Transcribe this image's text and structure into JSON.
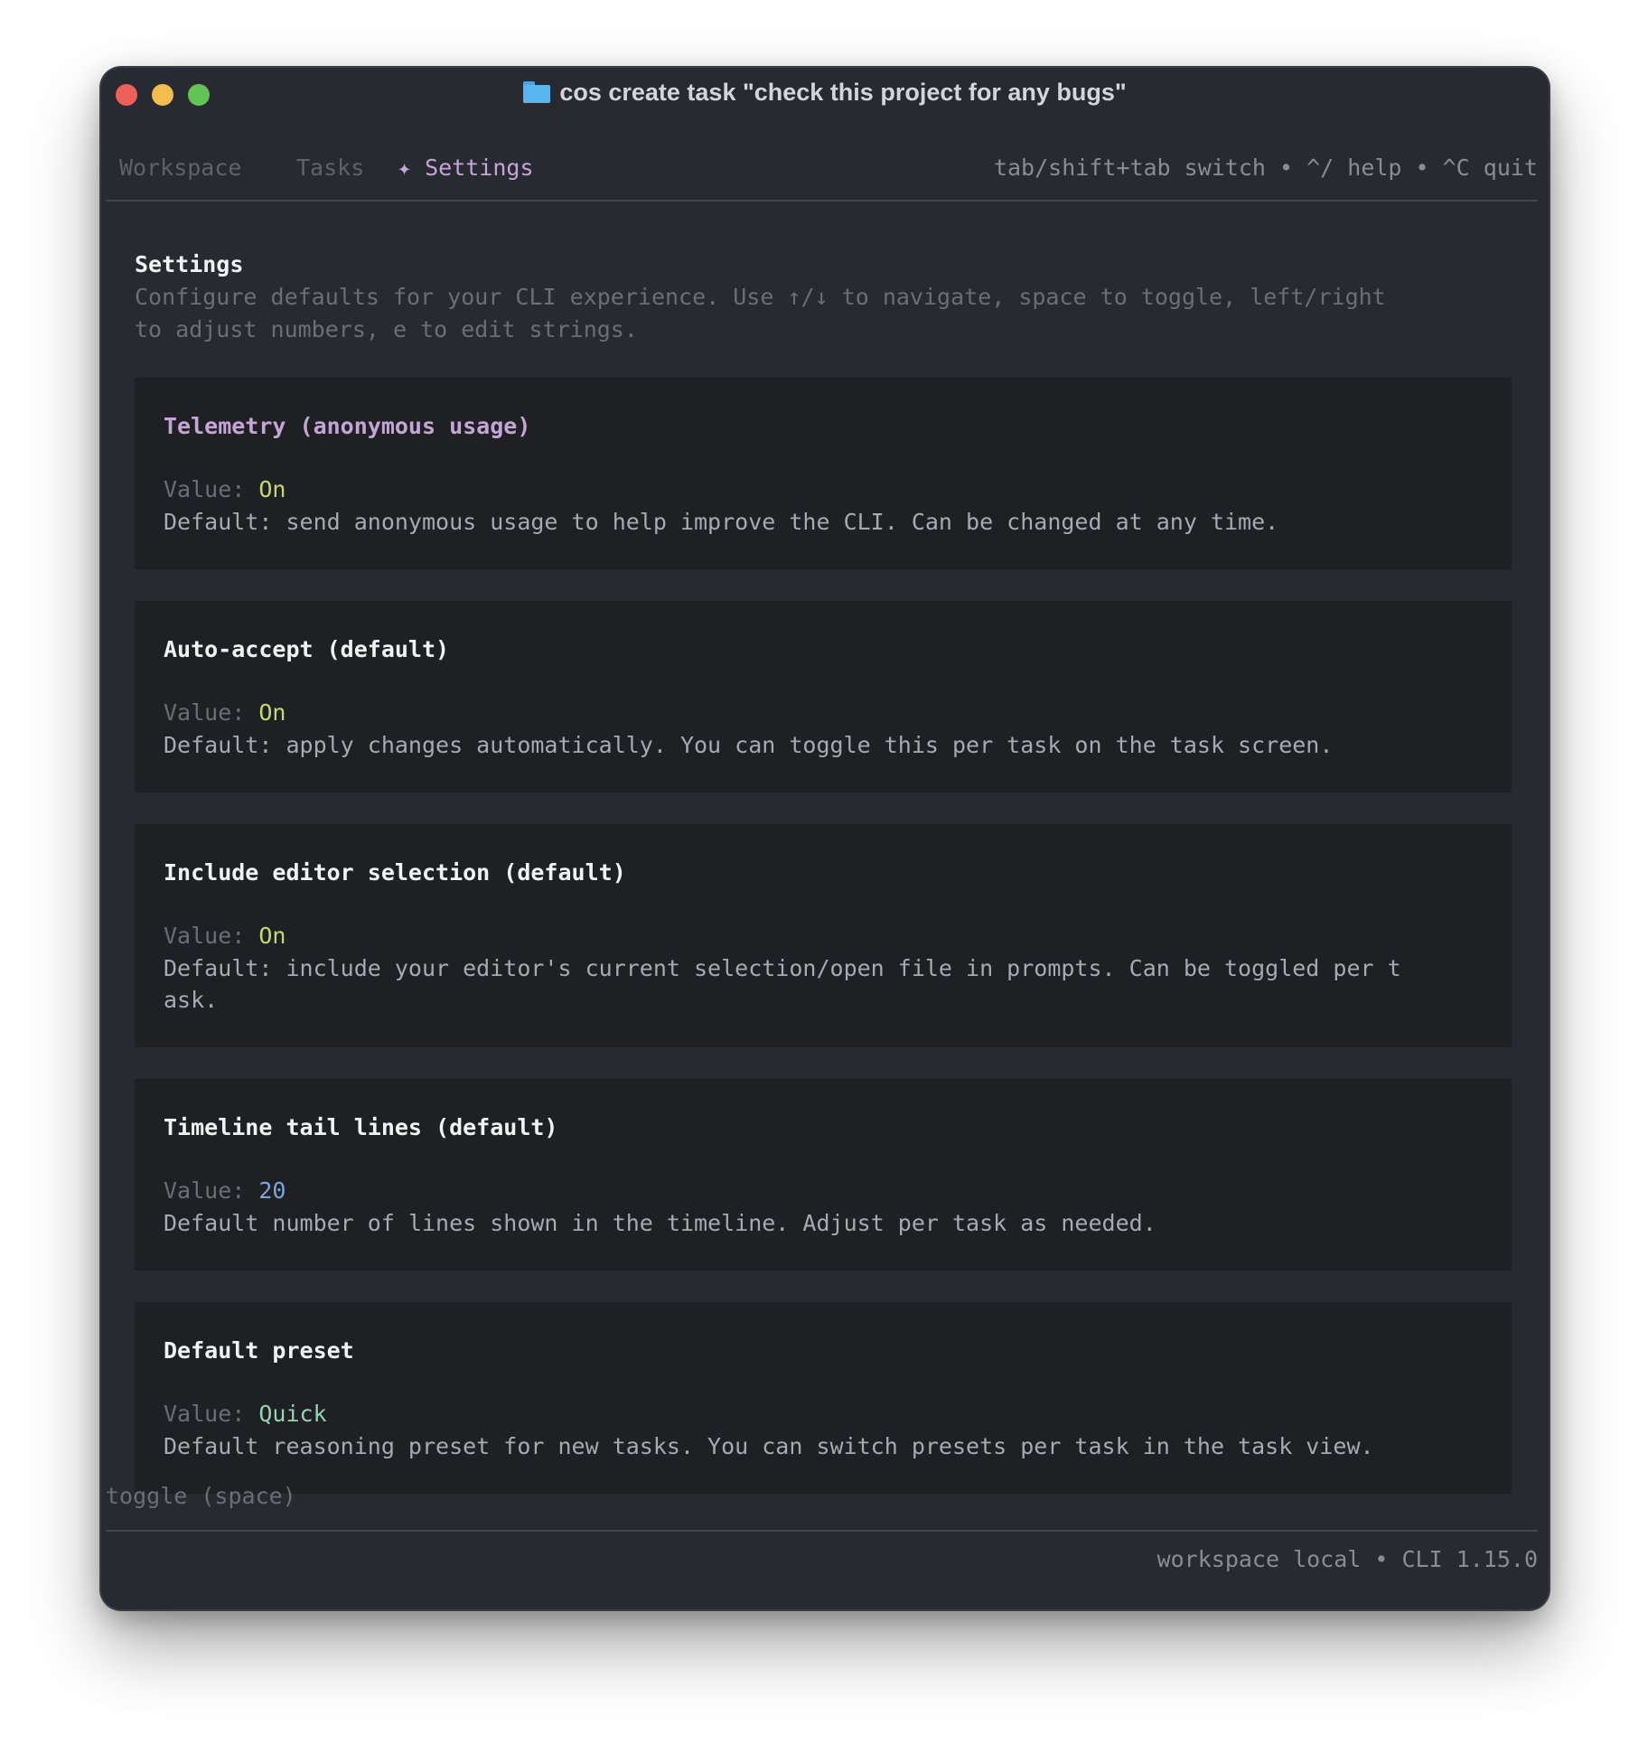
{
  "window": {
    "title": "cos create task \"check this project for any bugs\"",
    "folder_icon": "folder-icon"
  },
  "nav": {
    "tabs": [
      {
        "label": "Workspace"
      },
      {
        "label": "Tasks"
      },
      {
        "label": "✦ Settings",
        "active": true
      }
    ],
    "hint": "tab/shift+tab switch • ^/ help • ^C quit"
  },
  "settings": {
    "title": "Settings",
    "description": "Configure defaults for your CLI experience. Use ↑/↓ to navigate, space to toggle, left/right\nto adjust numbers, e to edit strings.",
    "value_label": "Value: ",
    "items": [
      {
        "title": "Telemetry (anonymous usage)",
        "value": "On",
        "description": "Default: send anonymous usage to help improve the CLI. Can be changed at any time."
      },
      {
        "title": "Auto-accept (default)",
        "value": "On",
        "description": "Default: apply changes automatically. You can toggle this per task on the task screen."
      },
      {
        "title": "Include editor selection (default)",
        "value": "On",
        "description": "Default: include your editor's current selection/open file in prompts. Can be toggled per t\nask."
      },
      {
        "title": "Timeline tail lines (default)",
        "value": "20",
        "description": "Default number of lines shown in the timeline. Adjust per task as needed."
      },
      {
        "title": "Default preset",
        "value": "Quick",
        "description": "Default reasoning preset for new tasks. You can switch presets per task in the task view."
      }
    ]
  },
  "footer": {
    "hint": "toggle (space)",
    "status": "workspace local • CLI 1.15.0"
  },
  "colors": {
    "background": "#282a32",
    "card": "#1f2024",
    "accent": "#c4a6d6",
    "value_on": "#c8d66f",
    "value_number": "#7ba6de",
    "value_string": "#96d4b0"
  }
}
